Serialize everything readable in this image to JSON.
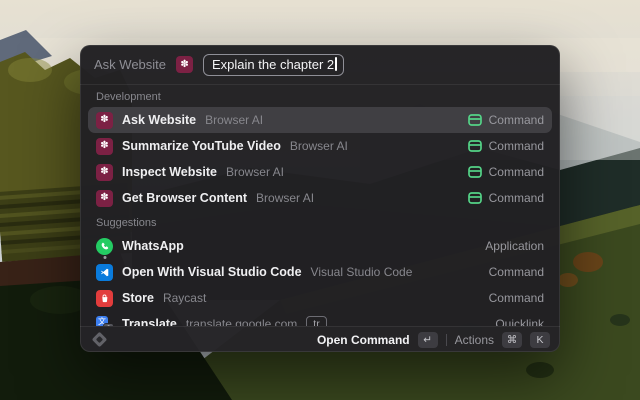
{
  "window": {
    "header": {
      "context_label": "Ask Website",
      "input_value": "Explain the chapter 2"
    },
    "sections": [
      {
        "label": "Development",
        "items": [
          {
            "title": "Ask Website",
            "subtitle": "Browser AI",
            "type": "Command",
            "icon": "browser-ai",
            "dev_icon": true,
            "selected": true
          },
          {
            "title": "Summarize YouTube Video",
            "subtitle": "Browser AI",
            "type": "Command",
            "icon": "browser-ai",
            "dev_icon": true,
            "selected": false
          },
          {
            "title": "Inspect Website",
            "subtitle": "Browser AI",
            "type": "Command",
            "icon": "browser-ai",
            "dev_icon": true,
            "selected": false
          },
          {
            "title": "Get Browser Content",
            "subtitle": "Browser AI",
            "type": "Command",
            "icon": "browser-ai",
            "dev_icon": true,
            "selected": false
          }
        ]
      },
      {
        "label": "Suggestions",
        "items": [
          {
            "title": "WhatsApp",
            "subtitle": "",
            "type": "Application",
            "icon": "whatsapp",
            "dev_icon": false,
            "selected": false,
            "running": true
          },
          {
            "title": "Open With Visual Studio Code",
            "subtitle": "Visual Studio Code",
            "type": "Command",
            "icon": "vscode",
            "dev_icon": false,
            "selected": false
          },
          {
            "title": "Store",
            "subtitle": "Raycast",
            "type": "Command",
            "icon": "raycast-store",
            "dev_icon": false,
            "selected": false
          },
          {
            "title": "Translate",
            "subtitle": "translate.google.com",
            "tag": "tr",
            "type": "Quicklink",
            "icon": "google-translate",
            "dev_icon": false,
            "selected": false
          }
        ]
      }
    ],
    "footer": {
      "primary_action": "Open Command",
      "primary_key": "↵",
      "actions_label": "Actions",
      "actions_keys": [
        "⌘",
        "K"
      ]
    }
  },
  "icon_glyphs": {
    "browser_ai": "✽",
    "google_translate_primary": "文",
    "google_translate_secondary": "a"
  },
  "colors": {
    "window_bg": "#222124",
    "selection_bg": "#403f43",
    "accent_dev_green": "#54d387",
    "browser_ai_crimson": "#7c2144",
    "whatsapp_green": "#24cc63",
    "vscode_blue": "#0a7bdc",
    "store_red": "#e23c3c",
    "translate_blue": "#3c7ef0"
  }
}
